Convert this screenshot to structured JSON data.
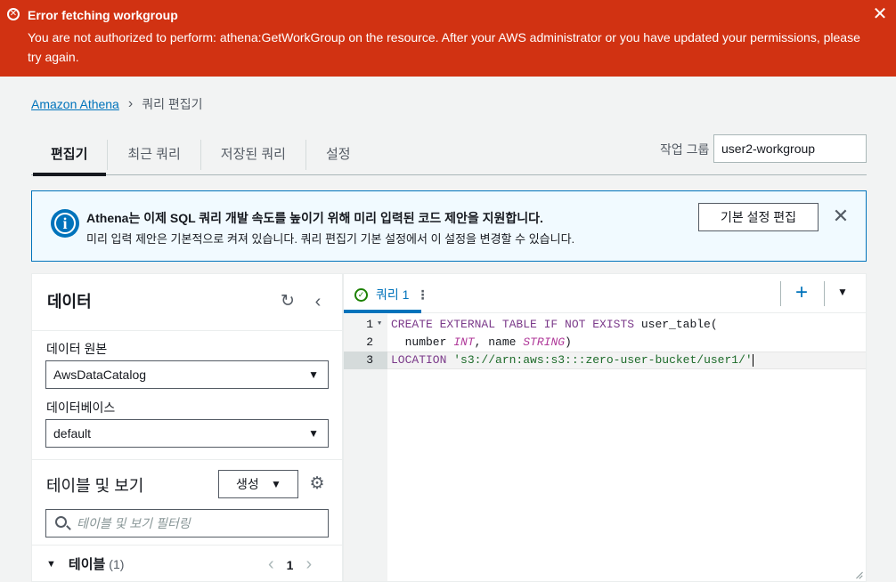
{
  "error_banner": {
    "title": "Error fetching workgroup",
    "message": "You are not authorized to perform: athena:GetWorkGroup on the resource. After your AWS administrator or you have updated your permissions, please try again.",
    "icon": "error-circle-icon",
    "color": "#d13212"
  },
  "breadcrumb": {
    "root": "Amazon Athena",
    "current": "쿼리 편집기"
  },
  "tabs": [
    {
      "label": "편집기",
      "active": true
    },
    {
      "label": "최근 쿼리",
      "active": false
    },
    {
      "label": "저장된 쿼리",
      "active": false
    },
    {
      "label": "설정",
      "active": false
    }
  ],
  "workgroup": {
    "label": "작업 그룹",
    "value": "user2-workgroup"
  },
  "info_banner": {
    "title": "Athena는 이제 SQL 쿼리 개발 속도를 높이기 위해 미리 입력된 코드 제안을 지원합니다.",
    "message": "미리 입력 제안은 기본적으로 켜져 있습니다. 쿼리 편집기 기본 설정에서 이 설정을 변경할 수 있습니다.",
    "button": "기본 설정 편집",
    "color": "#0073bb"
  },
  "data_panel": {
    "title": "데이터",
    "data_source_label": "데이터 원본",
    "data_source_value": "AwsDataCatalog",
    "database_label": "데이터베이스",
    "database_value": "default",
    "tables_views_title": "테이블 및 보기",
    "create_button": "생성",
    "filter_placeholder": "테이블 및 보기 필터링",
    "tables_label": "테이블",
    "tables_count": "(1)",
    "page": "1"
  },
  "editor": {
    "query_tab": "쿼리 1",
    "line_numbers": [
      "1",
      "2",
      "3"
    ],
    "code": {
      "line1_kw1": "CREATE EXTERNAL TABLE IF NOT EXISTS",
      "line1_rest": " user_table(",
      "line2_a": "  number ",
      "line2_type1": "INT",
      "line2_b": ", name ",
      "line2_type2": "STRING",
      "line2_c": ")",
      "line3_kw": "LOCATION",
      "line3_str": " 's3://arn:aws:s3:::zero-user-bucket/user1/'"
    }
  }
}
